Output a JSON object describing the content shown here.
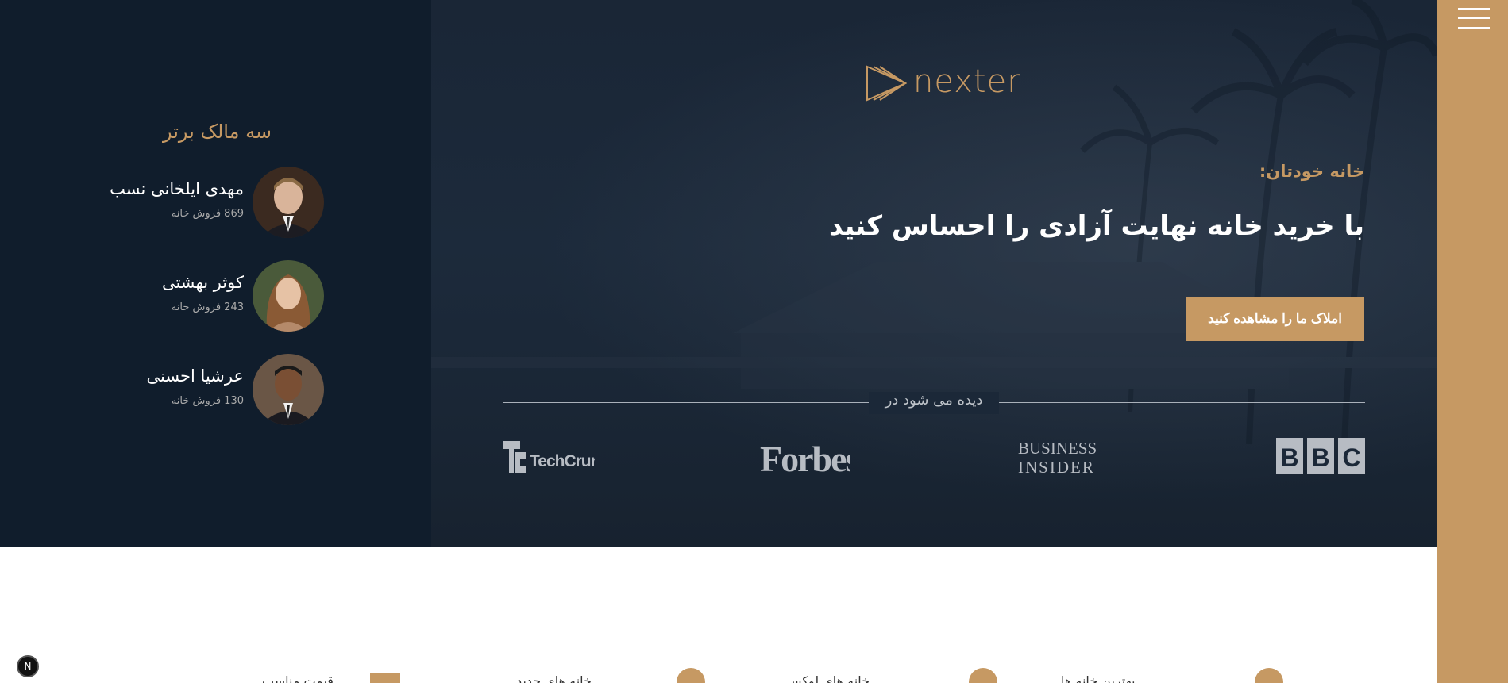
{
  "menu": {
    "icon": "hamburger-icon"
  },
  "realtors": {
    "title": "سه مالک برتر",
    "items": [
      {
        "name": "مهدی ایلخانی نسب",
        "sold": "869 فروش خانه"
      },
      {
        "name": "کوثر بهشتی",
        "sold": "243 فروش خانه"
      },
      {
        "name": "عرشیا احسنی",
        "sold": "130 فروش خانه"
      }
    ]
  },
  "hero": {
    "logo_text": "nexter",
    "subtitle": "خانه خودتان:",
    "heading": "با خرید خانه نهایت آزادی را احساس کنید",
    "cta_label": "املاک ما را مشاهده کنید",
    "seen_on": "دیده می شود در",
    "press": [
      "TechCrunch",
      "Forbes",
      "BUSINESS",
      "INSIDER",
      "BBC"
    ]
  },
  "features": {
    "items": [
      {
        "label": "بهترین خانه ها",
        "icon": "globe-icon"
      },
      {
        "label": "خانه های لوکس",
        "icon": "circle-icon"
      },
      {
        "label": "خانه های جدید",
        "icon": "info-icon"
      },
      {
        "label": "قیمت مناسب",
        "icon": "key-icon"
      }
    ]
  },
  "badge": "N",
  "colors": {
    "primary": "#c69963",
    "dark": "#101d2c"
  }
}
